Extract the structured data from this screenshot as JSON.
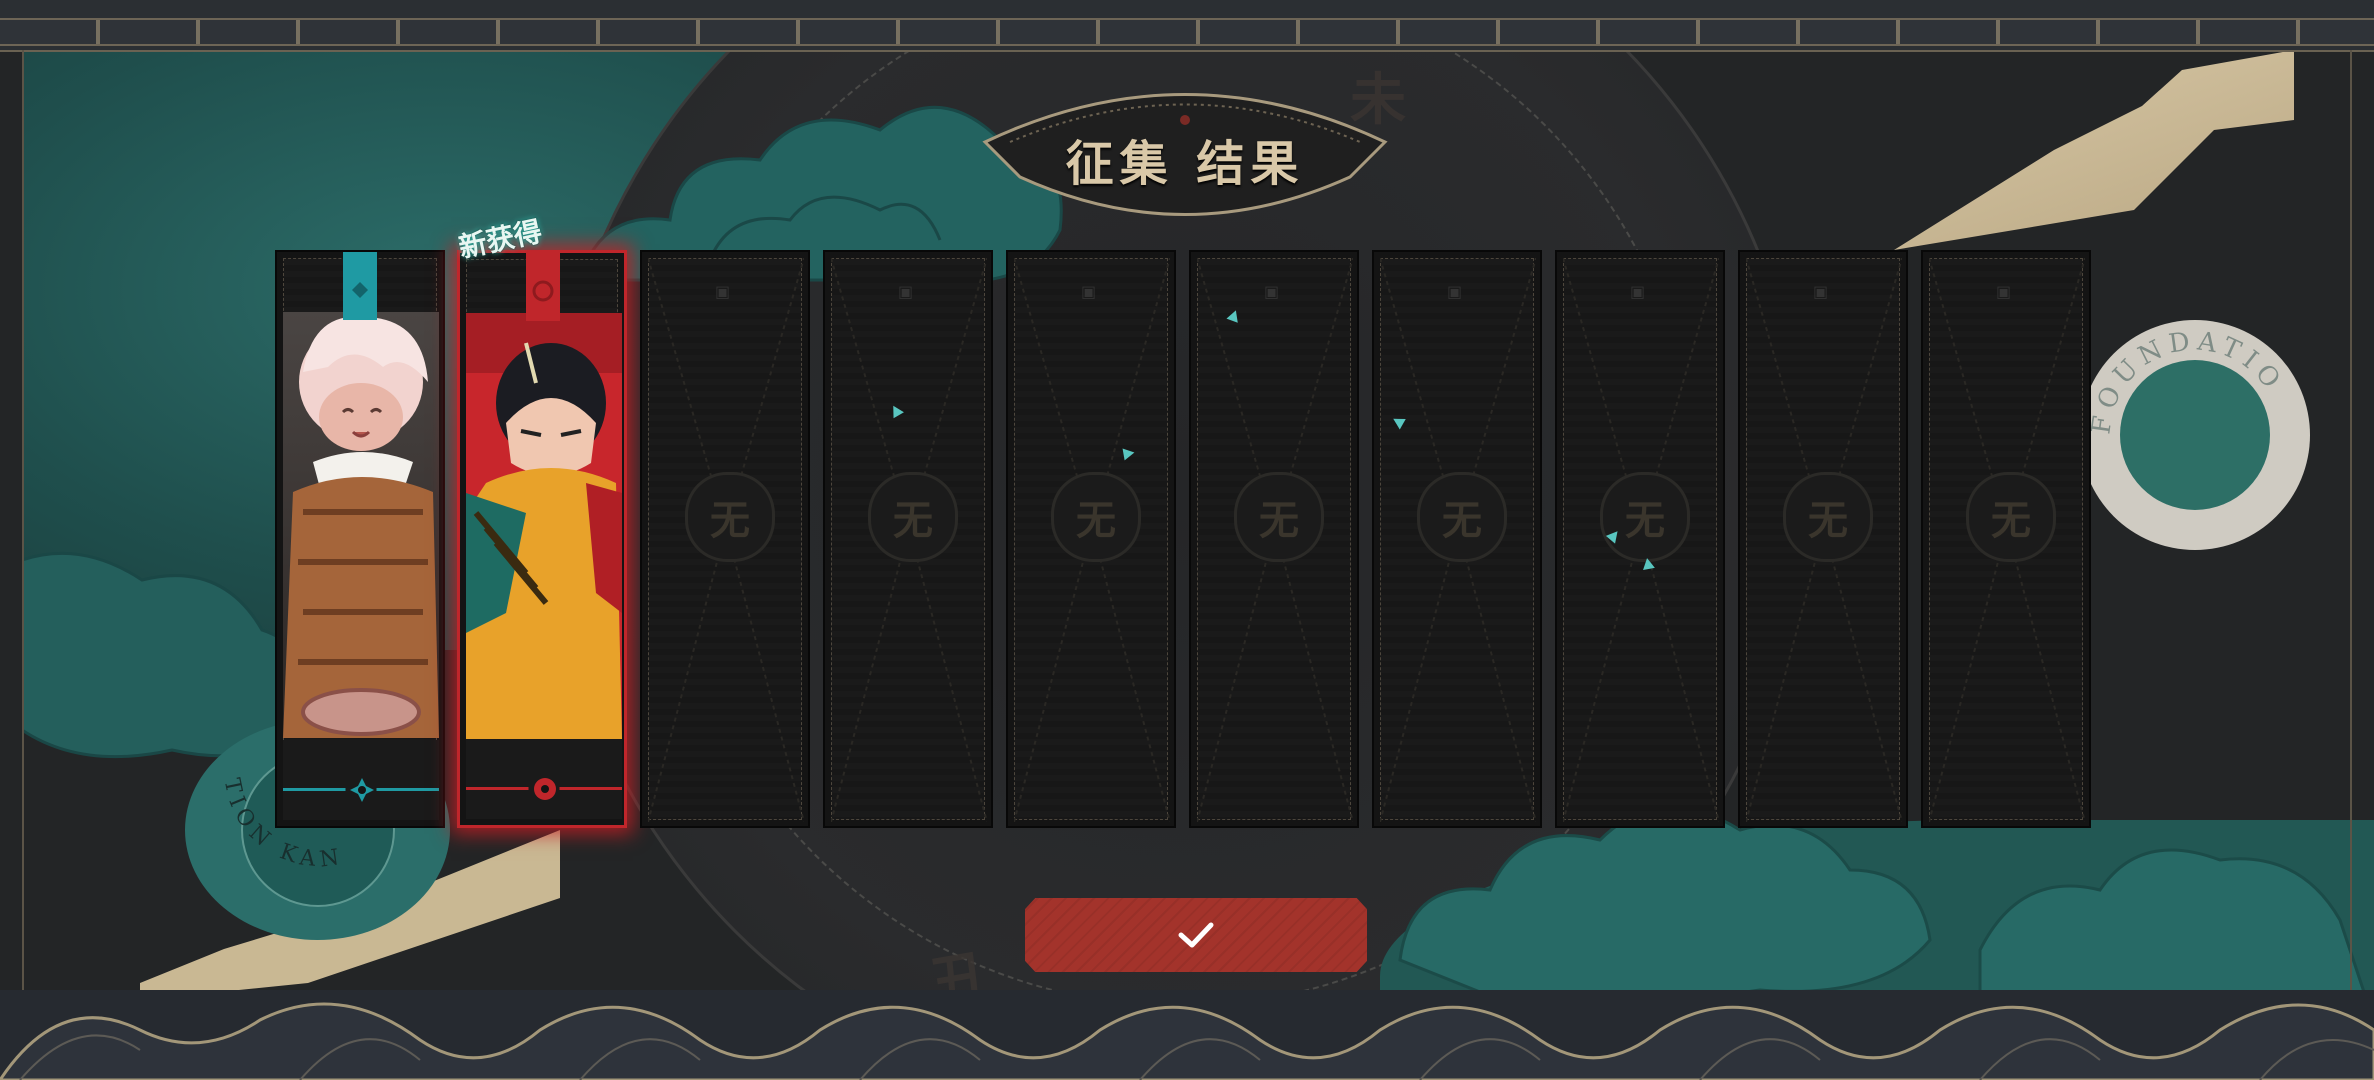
{
  "screen": {
    "title": "征集 结果",
    "new_badge": "新获得",
    "confirm_icon": "check-icon",
    "seal_text_right": "FOUNDATIO",
    "seal_text_left": "TION KAN"
  },
  "background": {
    "zodiac_chars": [
      "未",
      "丑"
    ]
  },
  "colors": {
    "teal": "#2b6e6a",
    "gold": "#d9c8a8",
    "red_accent": "#c0262b",
    "confirm_button": "#a3332b"
  },
  "cards": [
    {
      "state": "obtained",
      "rarity_color": "#1f9aa3",
      "portrait": "pink-haired-character",
      "emblem": "teal-flower-icon"
    },
    {
      "state": "obtained-new",
      "rarity_color": "#c0262b",
      "portrait": "dark-haired-character",
      "emblem": "red-flower-icon"
    },
    {
      "state": "empty",
      "placeholder_char": "无"
    },
    {
      "state": "empty",
      "placeholder_char": "无"
    },
    {
      "state": "empty",
      "placeholder_char": "无"
    },
    {
      "state": "empty",
      "placeholder_char": "无"
    },
    {
      "state": "empty",
      "placeholder_char": "无"
    },
    {
      "state": "empty",
      "placeholder_char": "无"
    },
    {
      "state": "empty",
      "placeholder_char": "无"
    },
    {
      "state": "empty",
      "placeholder_char": "无"
    }
  ]
}
